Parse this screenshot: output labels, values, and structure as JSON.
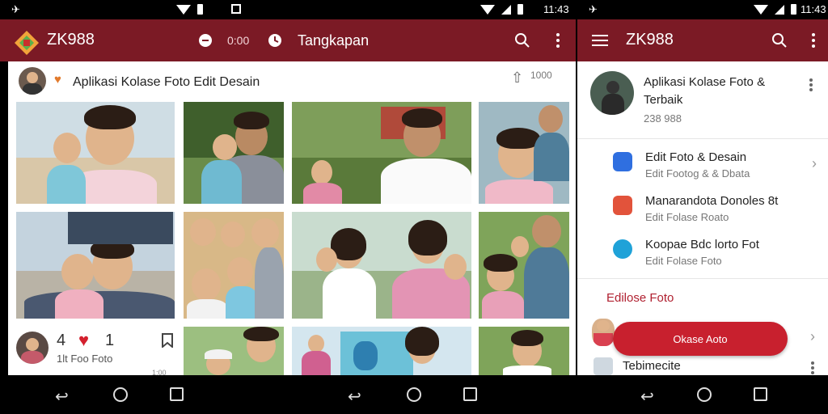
{
  "status_left": {
    "time": "11:43"
  },
  "status_mid": {
    "time": "11:43"
  },
  "status_right": {
    "time": "11:43"
  },
  "appbar_left": {
    "title": "ZK988",
    "counter": "0:00",
    "tab_label": "Tangkapan"
  },
  "appbar_right": {
    "title": "ZK988"
  },
  "post": {
    "title": "Aplikasi Kolase Foto Edit Desain",
    "count_top": "1000",
    "likes": "4",
    "comments": "1",
    "caption": "1lt Foo Foto",
    "timestamp": "1:00"
  },
  "profile": {
    "title_line1": "Aplikasi Kolase Foto &",
    "title_line2": "Terbaik",
    "followers": "238 988"
  },
  "menu": [
    {
      "title": "Edit Foto & Desain",
      "subtitle": "Edit Footog & & Dbata",
      "color": "#2f6fe0"
    },
    {
      "title": "Manarandota Donoles 8t",
      "subtitle": "Edit Folase Roato",
      "color": "#e2533b"
    },
    {
      "title": "Koopae Bdc lorto Fot",
      "subtitle": "Edit Folase Foto",
      "color": "#1fa2d8"
    }
  ],
  "section": {
    "title": "Edilose Foto"
  },
  "cta": {
    "label": "Okase Aoto"
  },
  "bottom_row": {
    "label": "Tebimecite"
  },
  "colors": {
    "brand": "#7b1a25",
    "accent": "#c8202e",
    "section_text": "#b02030"
  }
}
